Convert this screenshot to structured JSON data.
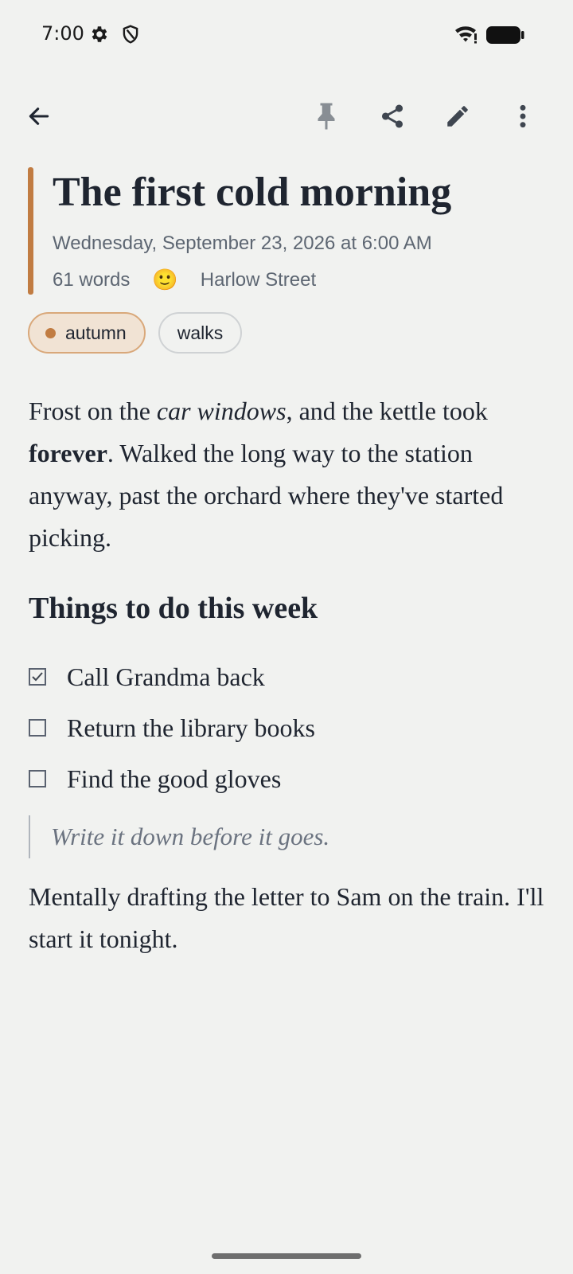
{
  "status_bar": {
    "time": "7:00",
    "icons": [
      "gear-icon",
      "shield-icon",
      "wifi-icon",
      "battery-icon"
    ]
  },
  "toolbar": {
    "icons": [
      "back-arrow-icon",
      "pin-icon",
      "share-icon",
      "edit-pencil-icon",
      "more-vert-icon"
    ]
  },
  "entry": {
    "title": "The first cold morning",
    "date": "Wednesday, September 23, 2026 at 6:00 AM",
    "word_count": "61 words",
    "mood": "🙂",
    "location": "Harlow Street",
    "accent_color": "#c17c42",
    "tags": [
      {
        "label": "autumn",
        "color": "#c17c42",
        "selected": true
      },
      {
        "label": "walks",
        "selected": false
      }
    ],
    "paragraph1": {
      "part1": "Frost on the ",
      "italic": "car windows",
      "part2": ", and the kettle took ",
      "bold": "forever",
      "part3": ". Walked the long way to the station anyway, past the orchard where they've started picking."
    },
    "heading": "Things to do this week",
    "checklist": [
      {
        "label": "Call Grandma back",
        "checked": true
      },
      {
        "label": "Return the library books",
        "checked": false
      },
      {
        "label": "Find the good gloves",
        "checked": false
      }
    ],
    "quote": "Write it down before it goes.",
    "paragraph2": "Mentally drafting the letter to Sam on the train. I'll start it tonight."
  }
}
